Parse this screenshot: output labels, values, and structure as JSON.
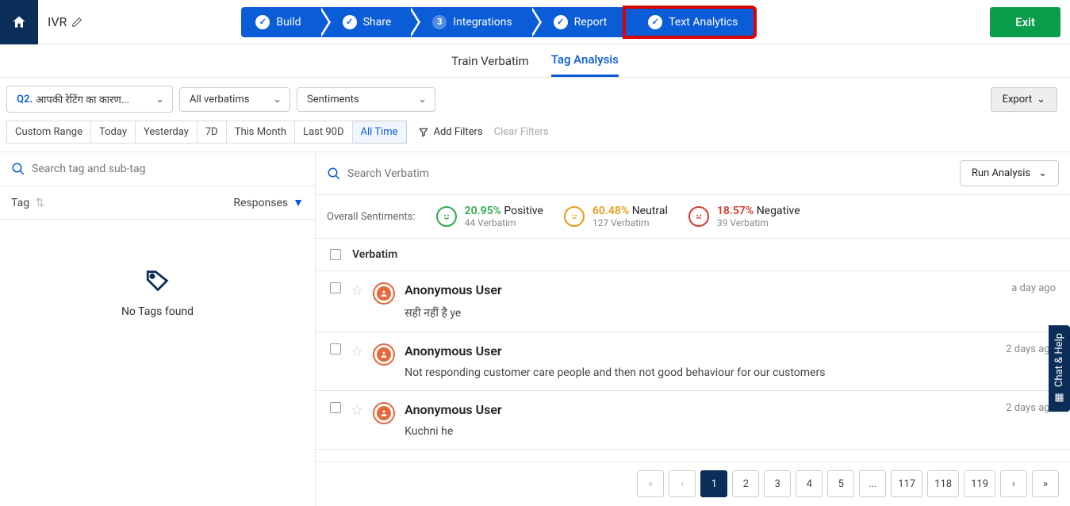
{
  "header": {
    "project_title": "IVR",
    "exit_label": "Exit",
    "steps": [
      {
        "label": "Build",
        "status": "check"
      },
      {
        "label": "Share",
        "status": "check"
      },
      {
        "label": "Integrations",
        "status": "num",
        "num": "3"
      },
      {
        "label": "Report",
        "status": "check"
      },
      {
        "label": "Text Analytics",
        "status": "check",
        "highlighted": true
      }
    ]
  },
  "sub_tabs": {
    "train": "Train Verbatim",
    "tag_analysis": "Tag Analysis",
    "active": "tag_analysis"
  },
  "filters": {
    "question_num": "Q2.",
    "question_text": "आपकी रेटिंग का कारण...",
    "verbatims_filter": "All verbatims",
    "sentiments_filter": "Sentiments",
    "export_label": "Export"
  },
  "time_ranges": [
    "Custom Range",
    "Today",
    "Yesterday",
    "7D",
    "This Month",
    "Last 90D",
    "All Time"
  ],
  "time_range_active": "All Time",
  "add_filters_label": "Add Filters",
  "clear_filters_label": "Clear Filters",
  "left_panel": {
    "search_placeholder": "Search tag and sub-tag",
    "tag_header": "Tag",
    "responses_header": "Responses",
    "no_tags_message": "No Tags found"
  },
  "right_panel": {
    "search_placeholder": "Search Verbatim",
    "run_analysis_label": "Run Analysis",
    "overall_label": "Overall Sentiments:",
    "sentiments": {
      "positive_pct": "20.95%",
      "positive_label": "Positive",
      "positive_sub": "44 Verbatim",
      "neutral_pct": "60.48%",
      "neutral_label": "Neutral",
      "neutral_sub": "127 Verbatim",
      "negative_pct": "18.57%",
      "negative_label": "Negative",
      "negative_sub": "39 Verbatim"
    },
    "verbatim_col": "Verbatim",
    "items": [
      {
        "user": "Anonymous User",
        "text": "सही नहीं है ye",
        "time": "a day ago"
      },
      {
        "user": "Anonymous User",
        "text": "Not responding customer care people and then not good behaviour for our customers",
        "time": "2 days ago"
      },
      {
        "user": "Anonymous User",
        "text": "Kuchni he",
        "time": "2 days ago"
      }
    ]
  },
  "pager": {
    "pages": [
      "1",
      "2",
      "3",
      "4",
      "5",
      "...",
      "117",
      "118",
      "119"
    ],
    "active": "1"
  },
  "help_tab": "Chat & Help"
}
